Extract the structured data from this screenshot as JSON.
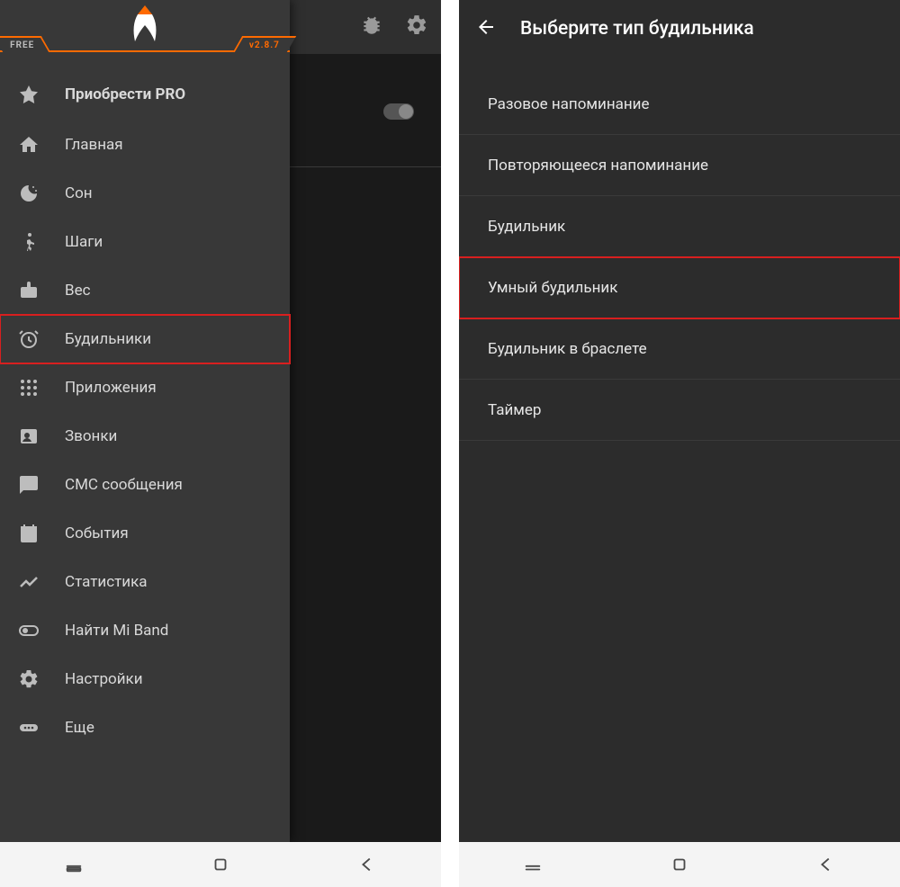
{
  "left": {
    "badge_free": "FREE",
    "version": "v2.8.7",
    "menu": [
      {
        "icon": "star-icon",
        "label": "Приобрести PRO"
      },
      {
        "icon": "home-icon",
        "label": "Главная"
      },
      {
        "icon": "moon-icon",
        "label": "Сон"
      },
      {
        "icon": "walk-icon",
        "label": "Шаги"
      },
      {
        "icon": "weight-icon",
        "label": "Вес"
      },
      {
        "icon": "alarm-icon",
        "label": "Будильники"
      },
      {
        "icon": "apps-icon",
        "label": "Приложения"
      },
      {
        "icon": "contact-icon",
        "label": "Звонки"
      },
      {
        "icon": "sms-icon",
        "label": "СМС сообщения"
      },
      {
        "icon": "calendar-icon",
        "label": "События"
      },
      {
        "icon": "chart-icon",
        "label": "Статистика"
      },
      {
        "icon": "toggle-icon",
        "label": "Найти Mi Band"
      },
      {
        "icon": "gear-icon",
        "label": "Настройки"
      },
      {
        "icon": "more-icon",
        "label": "Еще"
      }
    ],
    "highlight_index": 5
  },
  "right": {
    "title": "Выберите тип будильника",
    "types": [
      "Разовое напоминание",
      "Повторяющееся напоминание",
      "Будильник",
      "Умный будильник",
      "Будильник в браслете",
      "Таймер"
    ],
    "highlight_index": 3
  },
  "colors": {
    "accent": "#ff6a00",
    "highlight": "#d81f1f"
  }
}
